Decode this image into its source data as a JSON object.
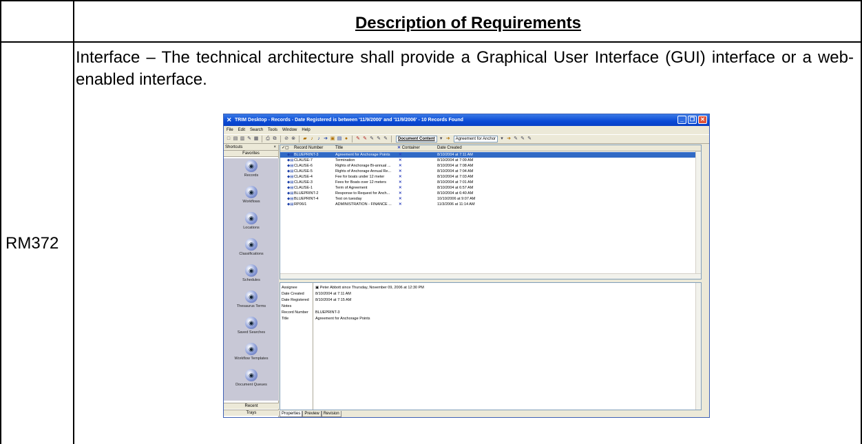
{
  "document": {
    "header_title": "Description of Requirements",
    "requirement_id": "RM372",
    "requirement_text": "Interface – The technical architecture shall provide a Graphical User Interface (GUI) interface or a web-enabled interface."
  },
  "screenshot": {
    "window_title": "TRIM Desktop - Records - Date Registered is between '11/9/2000' and '11/9/2006' - 10 Records Found",
    "menu": [
      "File",
      "Edit",
      "Search",
      "Tools",
      "Window",
      "Help"
    ],
    "toolbar": {
      "document_content_label": "Document Content",
      "search_value": "Agreement for Anchor"
    },
    "shortcuts": {
      "header": "Shortcuts",
      "favorites": "Favorites",
      "items": [
        {
          "label": "Records",
          "icon": "records-icon"
        },
        {
          "label": "Workflows",
          "icon": "workflows-icon"
        },
        {
          "label": "Locations",
          "icon": "locations-icon"
        },
        {
          "label": "Classifications",
          "icon": "classifications-icon"
        },
        {
          "label": "Schedules",
          "icon": "schedules-icon"
        },
        {
          "label": "Thesaurus Terms",
          "icon": "thesaurus-icon"
        },
        {
          "label": "Saved Searches",
          "icon": "saved-searches-icon"
        },
        {
          "label": "Workflow Templates",
          "icon": "workflow-templates-icon"
        },
        {
          "label": "Document Queues",
          "icon": "document-queues-icon"
        }
      ],
      "recent": "Recent",
      "trays": "Trays"
    },
    "list": {
      "columns": [
        "Record Number",
        "Title",
        "Container",
        "Date Created"
      ],
      "rows": [
        {
          "number": "BLUEPRINT-3",
          "title": "Agreement for Anchorage Points",
          "date": "8/10/2004 at 7:11 AM",
          "selected": true
        },
        {
          "number": "CLAUSE-7",
          "title": "Termination",
          "date": "8/10/2004 at 7:09 AM"
        },
        {
          "number": "CLAUSE-6",
          "title": "Rights of Anchorage Bi-annual ...",
          "date": "8/10/2004 at 7:08 AM"
        },
        {
          "number": "CLAUSE-5",
          "title": "Rights of Anchorage Annual Re...",
          "date": "8/10/2004 at 7:04 AM"
        },
        {
          "number": "CLAUSE-4",
          "title": "Fee for boats under 12 meter",
          "date": "8/10/2004 at 7:03 AM"
        },
        {
          "number": "CLAUSE-3",
          "title": "Fees for Boats over 12 meters",
          "date": "8/10/2004 at 7:01 AM"
        },
        {
          "number": "CLAUSE-1",
          "title": "Term of Agreement",
          "date": "8/10/2004 at 6:57 AM"
        },
        {
          "number": "BLUEPRINT-2",
          "title": "Response to Request for Anch...",
          "date": "8/10/2004 at 6:40 AM"
        },
        {
          "number": "BLUEPRINT-4",
          "title": "Test on tuesday",
          "date": "10/10/2006 at 9:07 AM"
        },
        {
          "number": "RP06/1",
          "title": "ADMINISTRATION - FINANCE ...",
          "date": "11/3/2006 at 11:14 AM"
        }
      ]
    },
    "properties": [
      {
        "label": "Assignee",
        "value": "Peter Abbott since Thursday, November 09, 2006 at 12:30 PM"
      },
      {
        "label": "Date Created",
        "value": "8/10/2004 at 7:11 AM"
      },
      {
        "label": "Date Registered",
        "value": "8/10/2004 at 7:15 AM"
      },
      {
        "label": "Notes",
        "value": ""
      },
      {
        "label": "Record Number",
        "value": "BLUEPRINT-3"
      },
      {
        "label": "Title",
        "value": "Agreement for Anchorage Points"
      }
    ],
    "tabs": [
      "Properties",
      "Preview",
      "Revision"
    ]
  }
}
